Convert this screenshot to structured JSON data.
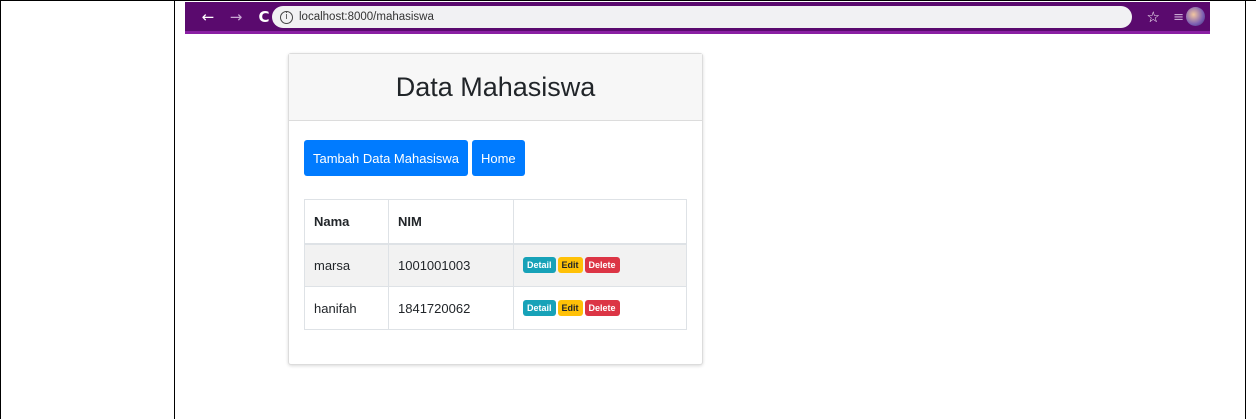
{
  "browser": {
    "back_icon": "←",
    "forward_icon": "→",
    "reload_icon": "C",
    "info_icon": "i",
    "url": "localhost:8000/mahasiswa",
    "star_icon": "☆",
    "menu_icon": "≡"
  },
  "page": {
    "title": "Data Mahasiswa",
    "buttons": {
      "add": "Tambah Data Mahasiswa",
      "home": "Home"
    },
    "table": {
      "headers": [
        "Nama",
        "NIM",
        ""
      ],
      "rows": [
        {
          "nama": "marsa",
          "nim": "1001001003"
        },
        {
          "nama": "hanifah",
          "nim": "1841720062"
        }
      ],
      "actions": {
        "detail": "Detail",
        "edit": "Edit",
        "delete": "Delete"
      }
    }
  },
  "colors": {
    "browser_bar": "#5a0a6e",
    "primary": "#007bff",
    "detail": "#17a2b8",
    "edit": "#ffc107",
    "delete": "#dc3545"
  }
}
